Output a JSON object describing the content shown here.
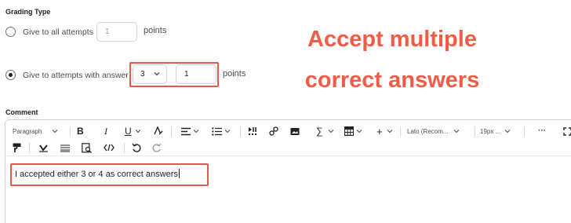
{
  "grading": {
    "title": "Grading Type",
    "option_all": {
      "label": "Give to all attempts",
      "value": "1",
      "unit": "points",
      "selected": false
    },
    "option_answer": {
      "label": "Give to attempts with answer",
      "answer_value": "3",
      "value": "1",
      "unit": "points",
      "selected": true
    }
  },
  "callout": {
    "line1": "Accept multiple",
    "line2": "correct answers",
    "color": "#f25b45"
  },
  "comment": {
    "title": "Comment",
    "toolbar": {
      "paragraph": "Paragraph",
      "bold": "B",
      "italic": "I",
      "underline": "U",
      "formula": "∑",
      "add": "+",
      "font": "Lato (Recom...",
      "size": "19px ...",
      "more": "···"
    },
    "text": "I accepted either 3 or 4 as correct answers"
  },
  "colors": {
    "highlight": "#e05a4e",
    "border": "#cdd5dc",
    "text": "#202122"
  },
  "icons": [
    "chevron-down-icon",
    "text-style-icon",
    "align-icon",
    "list-icon",
    "insert-stuff-icon",
    "link-icon",
    "image-icon",
    "table-icon",
    "fullscreen-icon",
    "format-painter-icon",
    "highlight-icon",
    "strikethrough-icon",
    "preview-icon",
    "source-code-icon",
    "undo-icon",
    "redo-icon"
  ]
}
